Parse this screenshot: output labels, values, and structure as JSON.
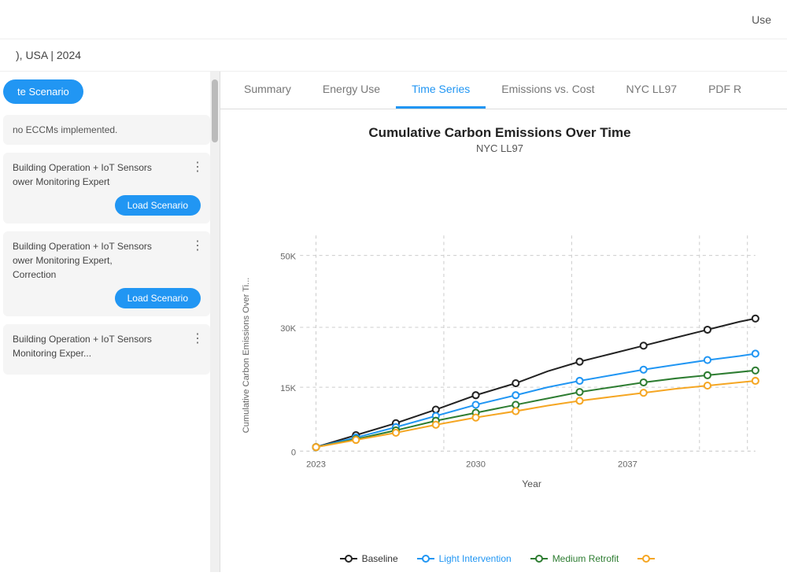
{
  "topbar": {
    "user_label": "Use"
  },
  "header": {
    "breadcrumb": "), USA | 2024"
  },
  "leftPanel": {
    "create_scenario_btn": "te Scenario",
    "no_eccm_card_text": "no ECCMs implemented.",
    "scenarios": [
      {
        "id": 1,
        "text": "Building Operation + IoT Sensors\nower Monitoring Expert",
        "load_btn": "Load Scenario"
      },
      {
        "id": 2,
        "text": "Building Operation + IoT Sensors\nower Monitoring Expert,\nCorrection",
        "load_btn": "Load Scenario"
      },
      {
        "id": 3,
        "text": "Building Operation + IoT Sensors\nMonitoring Exper...",
        "load_btn": null
      }
    ]
  },
  "tabs": [
    {
      "id": "summary",
      "label": "Summary",
      "active": false
    },
    {
      "id": "energy-use",
      "label": "Energy Use",
      "active": false
    },
    {
      "id": "time-series",
      "label": "Time Series",
      "active": true
    },
    {
      "id": "emissions-cost",
      "label": "Emissions vs. Cost",
      "active": false
    },
    {
      "id": "nyc-ll97",
      "label": "NYC LL97",
      "active": false
    },
    {
      "id": "pdf",
      "label": "PDF R",
      "active": false
    }
  ],
  "chart": {
    "title": "Cumulative Carbon Emissions Over Time",
    "subtitle": "NYC LL97",
    "y_axis_label": "Cumulative Carbon Emissions Over Ti...",
    "x_axis_label": "Year",
    "y_ticks": [
      "0",
      "15K",
      "30K",
      "50K"
    ],
    "x_ticks": [
      "2023",
      "2030",
      "2037"
    ],
    "colors": {
      "baseline": "#222222",
      "light_intervention": "#2196F3",
      "medium_retrofit": "#2e7d32",
      "fourth_line": "#f5a623"
    },
    "legend": [
      {
        "id": "baseline",
        "label": "Baseline",
        "color": "#222222"
      },
      {
        "id": "light-intervention",
        "label": "Light Intervention",
        "color": "#2196F3"
      },
      {
        "id": "medium-retrofit",
        "label": "Medium Retrofit",
        "color": "#2e7d32"
      },
      {
        "id": "fourth",
        "label": "",
        "color": "#f5a623"
      }
    ]
  }
}
